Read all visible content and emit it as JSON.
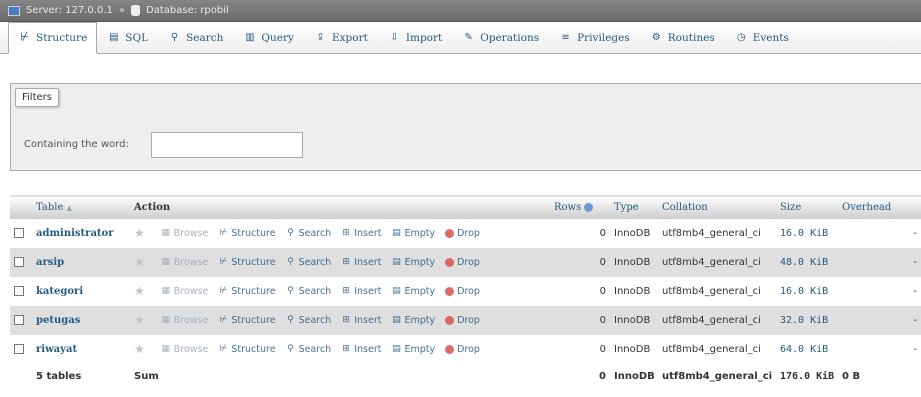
{
  "breadcrumb": {
    "server": "Server: 127.0.0.1",
    "database": "Database: rpobil",
    "separator": "»"
  },
  "tabs": [
    {
      "label": "Structure",
      "icon": "structure-icon",
      "glyph": "⊬",
      "active": true
    },
    {
      "label": "SQL",
      "icon": "sql-icon",
      "glyph": "▤"
    },
    {
      "label": "Search",
      "icon": "search-icon",
      "glyph": "⚲"
    },
    {
      "label": "Query",
      "icon": "query-icon",
      "glyph": "▥"
    },
    {
      "label": "Export",
      "icon": "export-icon",
      "glyph": "⇪"
    },
    {
      "label": "Import",
      "icon": "import-icon",
      "glyph": "⇩"
    },
    {
      "label": "Operations",
      "icon": "operations-icon",
      "glyph": "✎"
    },
    {
      "label": "Privileges",
      "icon": "privileges-icon",
      "glyph": "≡"
    },
    {
      "label": "Routines",
      "icon": "routines-icon",
      "glyph": "⚙"
    },
    {
      "label": "Events",
      "icon": "events-icon",
      "glyph": "◷"
    }
  ],
  "filters": {
    "legend": "Filters",
    "label": "Containing the word:",
    "value": ""
  },
  "table": {
    "headers": {
      "table": "Table",
      "sort_glyph": "▲",
      "action": "Action",
      "rows": "Rows",
      "type": "Type",
      "collation": "Collation",
      "size": "Size",
      "overhead": "Overhead"
    },
    "action_labels": {
      "browse": "Browse",
      "structure": "Structure",
      "search": "Search",
      "insert": "Insert",
      "empty": "Empty",
      "drop": "Drop"
    },
    "rows": [
      {
        "name": "administrator",
        "rows": "0",
        "type": "InnoDB",
        "collation": "utf8mb4_general_ci",
        "size": "16.0 KiB",
        "overhead": "-"
      },
      {
        "name": "arsip",
        "rows": "0",
        "type": "InnoDB",
        "collation": "utf8mb4_general_ci",
        "size": "48.0 KiB",
        "overhead": "-"
      },
      {
        "name": "kategori",
        "rows": "0",
        "type": "InnoDB",
        "collation": "utf8mb4_general_ci",
        "size": "16.0 KiB",
        "overhead": "-"
      },
      {
        "name": "petugas",
        "rows": "0",
        "type": "InnoDB",
        "collation": "utf8mb4_general_ci",
        "size": "32.0 KiB",
        "overhead": "-"
      },
      {
        "name": "riwayat",
        "rows": "0",
        "type": "InnoDB",
        "collation": "utf8mb4_general_ci",
        "size": "64.0 KiB",
        "overhead": "-"
      }
    ],
    "footer": {
      "count": "5 tables",
      "sum": "Sum",
      "rows": "0",
      "type": "InnoDB",
      "collation": "utf8mb4_general_ci",
      "size": "176.0 KiB",
      "overhead": "0 B"
    }
  }
}
